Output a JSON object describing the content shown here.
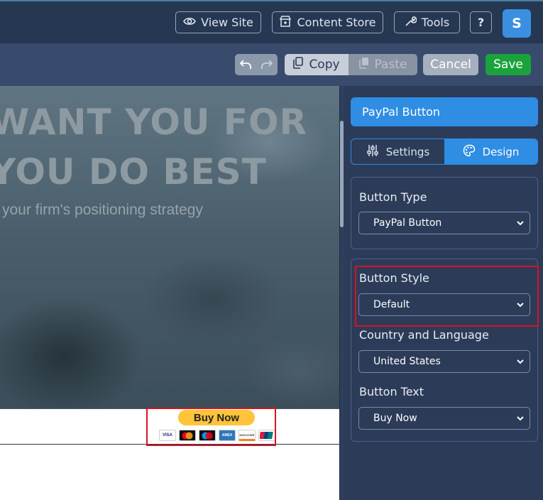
{
  "topbar": {
    "view_site": "View Site",
    "content_store": "Content Store",
    "tools": "Tools",
    "help": "?",
    "avatar_initial": "S"
  },
  "toolbar": {
    "copy": "Copy",
    "paste": "Paste",
    "cancel": "Cancel",
    "save": "Save"
  },
  "canvas": {
    "hero_line1": "WANT YOU FOR",
    "hero_line2": "YOU DO BEST",
    "hero_sub": "your firm's positioning strategy",
    "buy_now": "Buy Now",
    "cards": [
      "VISA",
      "MC",
      "Maestro",
      "AMEX",
      "DISCOVER",
      "UnionPay"
    ]
  },
  "panel": {
    "title": "PayPal Button",
    "tabs": [
      {
        "label": "Settings",
        "active": false
      },
      {
        "label": "Design",
        "active": true
      }
    ],
    "button_type": {
      "label": "Button Type",
      "value": "PayPal Button"
    },
    "button_style": {
      "label": "Button Style",
      "value": "Default"
    },
    "country_language": {
      "label": "Country and Language",
      "value": "United States"
    },
    "button_text": {
      "label": "Button Text",
      "value": "Buy Now"
    }
  },
  "colors": {
    "accent": "#2f8de4",
    "save_green": "#1aa33b",
    "highlight_red": "#d7131f",
    "paypal_yellow": "#ffc439"
  }
}
